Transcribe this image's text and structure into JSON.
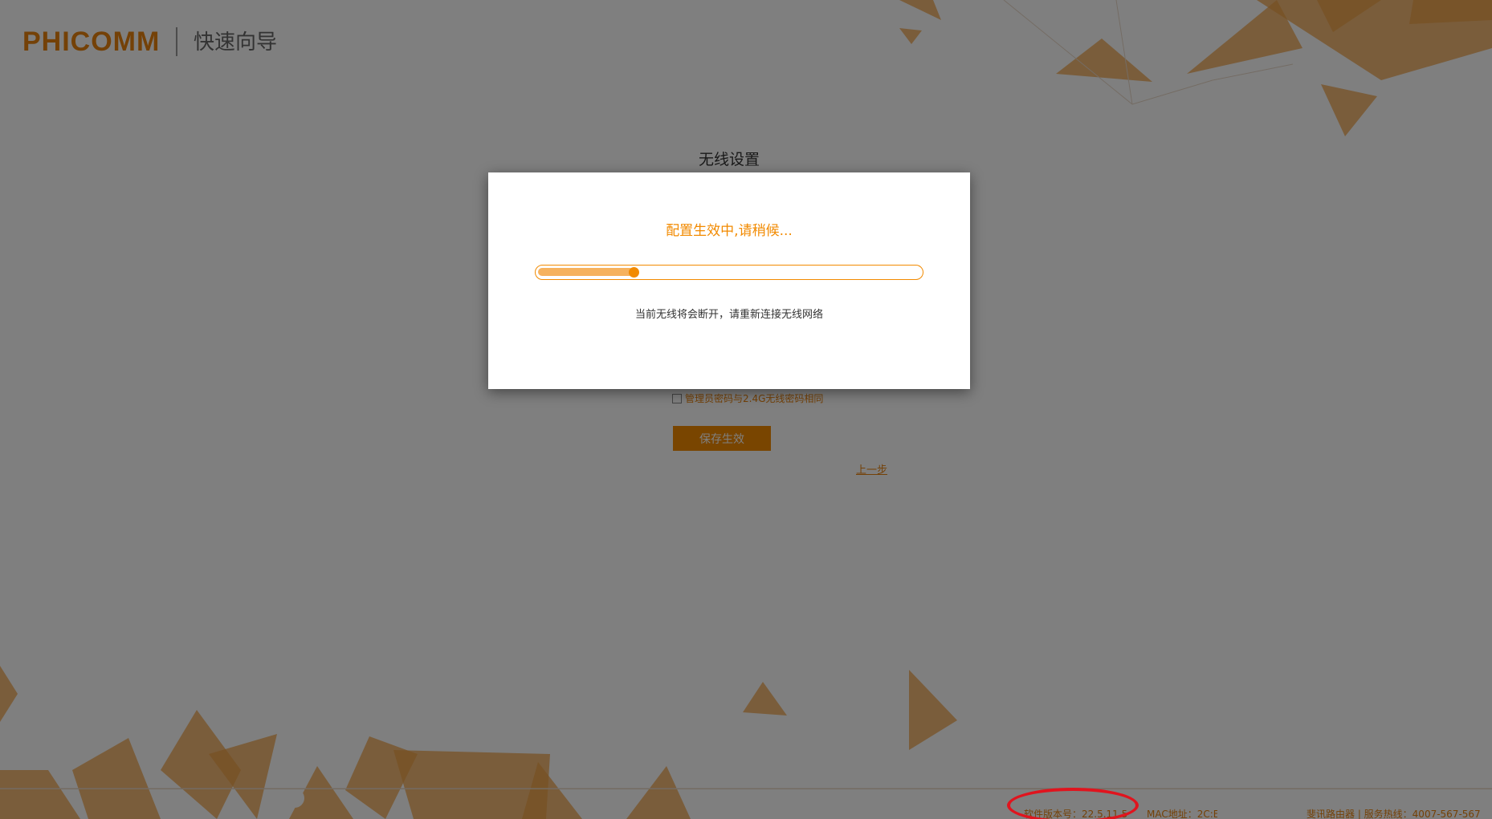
{
  "header": {
    "logo_text": "PHICOMM",
    "wizard_title": "快速向导"
  },
  "page": {
    "section_title": "无线设置",
    "sync_password_label": "管理员密码与2.4G无线密码相同",
    "save_button_label": "保存生效",
    "prev_link_label": "上一步"
  },
  "dialog": {
    "status_text": "配置生效中,请稍候...",
    "notice_text": "当前无线将会断开，请重新连接无线网络",
    "progress": 0.25
  },
  "footer": {
    "version_text": "软件版本号：22.5.11.5",
    "mac_text": "MAC地址：2C:E",
    "brand_text": "斐讯路由器 | 服务热线：4007-567-567"
  },
  "colors": {
    "accent": "#f28a00",
    "accent_light": "#f6b25e",
    "highlight_circle": "#e0141e"
  }
}
